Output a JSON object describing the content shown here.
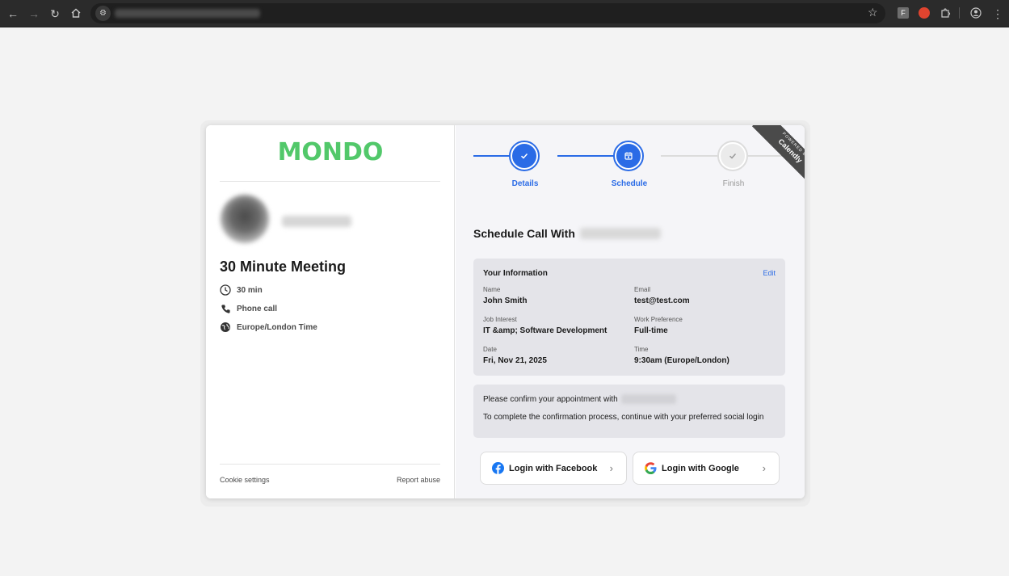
{
  "browser": {
    "url_display": ""
  },
  "left_panel": {
    "logo": "MONDO",
    "meeting_title": "30 Minute Meeting",
    "details": [
      {
        "icon": "clock-icon",
        "label": "30 min"
      },
      {
        "icon": "phone-icon",
        "label": "Phone call"
      },
      {
        "icon": "globe-icon",
        "label": "Europe/London Time"
      }
    ],
    "cookie_settings": "Cookie settings",
    "report_abuse": "Report abuse"
  },
  "stepper": {
    "steps": [
      {
        "label": "Details",
        "state": "done"
      },
      {
        "label": "Schedule",
        "state": "current"
      },
      {
        "label": "Finish",
        "state": "pending"
      }
    ],
    "accent": "#2a6be6"
  },
  "ribbon": {
    "small": "POWERED BY",
    "big": "Calendly"
  },
  "schedule_heading": "Schedule Call With",
  "info": {
    "title": "Your Information",
    "edit": "Edit",
    "fields": [
      {
        "label": "Name",
        "value": "John Smith"
      },
      {
        "label": "Email",
        "value": "test@test.com"
      },
      {
        "label": "Job Interest",
        "value": "IT &amp; Software Development"
      },
      {
        "label": "Work Preference",
        "value": "Full-time"
      },
      {
        "label": "Date",
        "value": "Fri, Nov 21, 2025"
      },
      {
        "label": "Time",
        "value": "9:30am (Europe/London)"
      }
    ]
  },
  "confirm": {
    "line1": "Please confirm your appointment with",
    "line2": "To complete the confirmation process, continue with your preferred social login"
  },
  "login": {
    "facebook": "Login with Facebook",
    "google": "Login with Google"
  },
  "colors": {
    "brand_green": "#52c86a",
    "accent_blue": "#2a6be6",
    "facebook_blue": "#1877f2"
  }
}
